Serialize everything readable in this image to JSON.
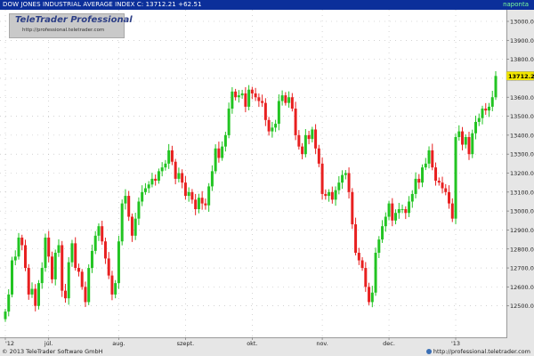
{
  "header": {
    "title": "DOW JONES INDUSTRIAL AVERAGE INDEX",
    "close_label": "C: 13712.21",
    "change_label": "+62.51",
    "period": "napontа"
  },
  "logo": {
    "brand": "TeleTrader Professional",
    "url": "http://professional.teletrader.com"
  },
  "footer": {
    "copyright": "© 2013 TeleTrader Software GmbH",
    "url": "http://professional.teletrader.com"
  },
  "chart_data": {
    "type": "candlestick",
    "title": "DOW JONES INDUSTRIAL AVERAGE INDEX",
    "last_value_label": "13712.21",
    "ylim": [
      12400,
      14000
    ],
    "y_ticks": [
      12500,
      12600,
      12700,
      12800,
      12900,
      13000,
      13100,
      13200,
      13300,
      13400,
      13500,
      13600,
      13700,
      13800,
      13900,
      14000
    ],
    "y_tick_labels": [
      "12500.00",
      "12600.00",
      "12700.00",
      "12800.00",
      "12900.00",
      "13000.00",
      "13100.00",
      "13200.00",
      "13300.00",
      "13400.00",
      "13500.00",
      "13600.00",
      "13700.00",
      "13800.00",
      "13900.00",
      "13000.00"
    ],
    "x_tick_labels": [
      "'12",
      "júl.",
      "aug.",
      "szept.",
      "okt.",
      "nov.",
      "dec.",
      "'13"
    ],
    "x_tick_index": [
      0,
      13,
      34,
      54,
      74,
      95,
      115,
      135
    ],
    "grid": true,
    "up_color": "#22c422",
    "down_color": "#e82020",
    "closes": [
      12470,
      12560,
      12740,
      12760,
      12860,
      12820,
      12700,
      12560,
      12590,
      12500,
      12620,
      12700,
      12860,
      12760,
      12640,
      12780,
      12820,
      12580,
      12540,
      12730,
      12830,
      12700,
      12680,
      12600,
      12520,
      12700,
      12790,
      12870,
      12920,
      12840,
      12750,
      12660,
      12560,
      12620,
      12840,
      13040,
      13080,
      12970,
      12870,
      12960,
      13050,
      13100,
      13120,
      13140,
      13170,
      13160,
      13210,
      13230,
      13250,
      13320,
      13260,
      13170,
      13200,
      13150,
      13080,
      13100,
      13060,
      13010,
      13070,
      13040,
      13030,
      13130,
      13210,
      13330,
      13280,
      13340,
      13400,
      13540,
      13630,
      13600,
      13610,
      13620,
      13550,
      13640,
      13620,
      13600,
      13580,
      13570,
      13480,
      13420,
      13440,
      13460,
      13580,
      13610,
      13570,
      13600,
      13540,
      13400,
      13340,
      13300,
      13400,
      13380,
      13430,
      13330,
      13250,
      13090,
      13080,
      13100,
      13060,
      13110,
      13150,
      13190,
      13200,
      13100,
      12930,
      12780,
      12740,
      12700,
      12600,
      12520,
      12570,
      12780,
      12850,
      12920,
      12970,
      13040,
      12950,
      12990,
      13010,
      13010,
      12990,
      13050,
      13090,
      13170,
      13150,
      13230,
      13250,
      13320,
      13230,
      13160,
      13150,
      13120,
      13100,
      13040,
      12960,
      13390,
      13420,
      13350,
      13390,
      13300,
      13410,
      13470,
      13490,
      13540,
      13530,
      13550,
      13600,
      13712.21
    ]
  }
}
